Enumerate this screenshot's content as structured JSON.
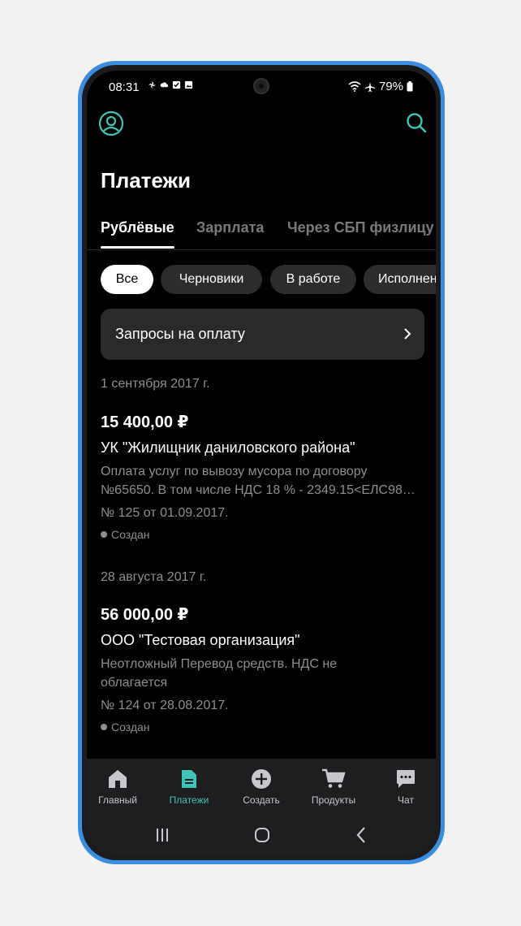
{
  "status_bar": {
    "time": "08:31",
    "battery": "79%",
    "left_icons": [
      "fan-icon",
      "cloud-icon",
      "checkbox-icon",
      "image-icon"
    ],
    "right_icons": [
      "wifi-icon",
      "airplane-icon",
      "battery-icon"
    ]
  },
  "header": {
    "title": "Платежи",
    "avatar_icon": "profile-icon",
    "search_icon": "search-icon"
  },
  "tabs": [
    {
      "label": "Рублёвые",
      "active": true
    },
    {
      "label": "Зарплата",
      "active": false
    },
    {
      "label": "Через СБП физлицу",
      "active": false
    }
  ],
  "filters": [
    {
      "label": "Все",
      "active": true
    },
    {
      "label": "Черновики",
      "active": false
    },
    {
      "label": "В работе",
      "active": false
    },
    {
      "label": "Исполнен",
      "active": false
    }
  ],
  "requests_card": {
    "label": "Запросы на оплату"
  },
  "payments": [
    {
      "date": "1 сентября 2017 г.",
      "amount": "15 400,00 ₽",
      "payee": "УК \"Жилищник даниловского района\"",
      "description_line1": "Оплата услуг по вывозу мусора по договору",
      "description_line2": "№65650. В том числе НДС 18 % - 2349.15<ЕЛС98…",
      "doc": "№ 125 от 01.09.2017.",
      "status": "Создан"
    },
    {
      "date": "28 августа 2017 г.",
      "amount": "56 000,00 ₽",
      "payee": "ООО \"Тестовая организация\"",
      "description_line1": "Неотложный Перевод средств. НДС не",
      "description_line2": "облагается",
      "doc": "№ 124 от 28.08.2017.",
      "status": "Создан"
    }
  ],
  "bottom_nav": [
    {
      "label": "Главный",
      "icon": "home-icon",
      "active": false
    },
    {
      "label": "Платежи",
      "icon": "document-icon",
      "active": true
    },
    {
      "label": "Создать",
      "icon": "plus-circle-icon",
      "active": false
    },
    {
      "label": "Продукты",
      "icon": "cart-icon",
      "active": false
    },
    {
      "label": "Чат",
      "icon": "chat-icon",
      "active": false
    }
  ],
  "colors": {
    "accent": "#3ec4b6",
    "frame": "#3b8de0",
    "background": "#000000",
    "card": "#2a2a2c",
    "muted_text": "#8e8e93"
  }
}
